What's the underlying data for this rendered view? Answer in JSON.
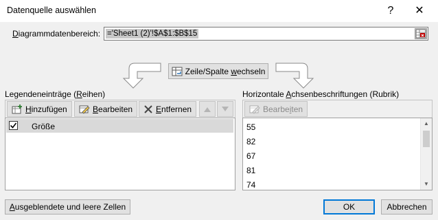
{
  "dialog": {
    "title": "Datenquelle auswählen",
    "help_glyph": "?",
    "close_glyph": "✕"
  },
  "range": {
    "label_before": "",
    "label_accel": "D",
    "label_after": "iagrammdatenbereich:",
    "value": "='Sheet1 (2)'!$A$1:$B$15"
  },
  "switch": {
    "label_before": "Zeile/Spalte ",
    "label_accel": "w",
    "label_after": "echseln"
  },
  "legend": {
    "label_before": "Legendeneinträge (",
    "label_accel": "R",
    "label_after": "eihen)",
    "add_accel": "H",
    "add_rest": "inzufügen",
    "edit_accel": "B",
    "edit_rest": "earbeiten",
    "remove_accel": "E",
    "remove_rest": "ntfernen",
    "items": [
      {
        "label": "Größe",
        "checked": true
      }
    ]
  },
  "category": {
    "label_before": "Horizontale ",
    "label_accel": "A",
    "label_after": "chsenbeschriftungen (Rubrik)",
    "edit_label_before": "Bearbe",
    "edit_accel": "i",
    "edit_label_after": "ten",
    "items": [
      "55",
      "82",
      "67",
      "81",
      "74"
    ]
  },
  "footer": {
    "hidden_accel": "A",
    "hidden_rest": "usgeblendete und leere Zellen",
    "ok": "OK",
    "cancel": "Abbrechen"
  },
  "colors": {
    "accent": "#0078d7",
    "dialog_bg": "#f0f0f0",
    "selection": "#d9d9d9"
  }
}
